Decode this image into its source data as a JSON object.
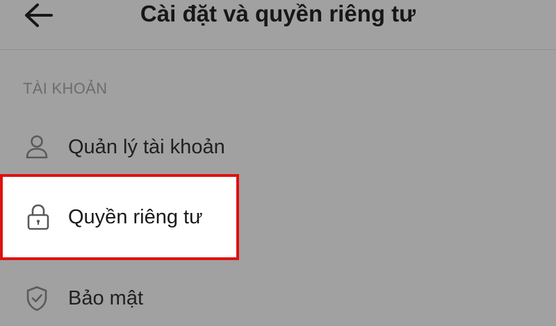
{
  "header": {
    "title": "Cài đặt và quyền riêng tư",
    "back_icon": "arrow-left-icon"
  },
  "section": {
    "label": "TÀI KHOẢN"
  },
  "items": [
    {
      "label": "Quản lý tài khoản",
      "icon": "person-icon"
    },
    {
      "label": "Quyền riêng tư",
      "icon": "lock-icon",
      "highlighted": true
    },
    {
      "label": "Bảo mật",
      "icon": "shield-check-icon"
    }
  ],
  "colors": {
    "background": "#a1a1a1",
    "highlight_border": "#e01010",
    "highlight_fill": "#ffffff"
  }
}
